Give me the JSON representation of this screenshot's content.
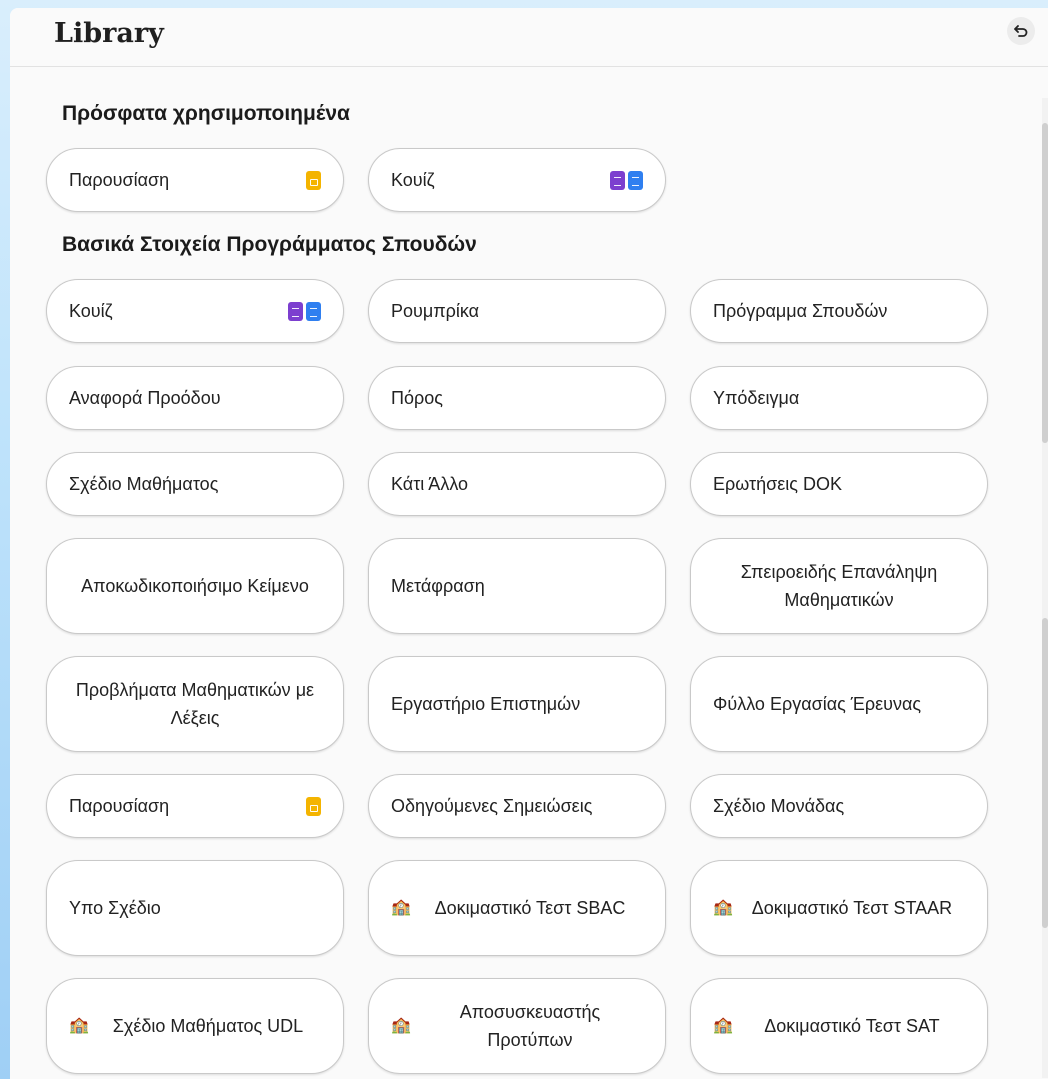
{
  "header": {
    "title": "Library",
    "undo_icon": "undo-icon"
  },
  "recent": {
    "title": "Πρόσφατα χρησιμοποιημένα",
    "items": [
      {
        "label": "Παρουσίαση",
        "icons": [
          "slides-icon"
        ]
      },
      {
        "label": "Κουίζ",
        "icons": [
          "forms-icon",
          "docs-icon"
        ]
      }
    ]
  },
  "curriculum": {
    "title": "Βασικά Στοιχεία Προγράμματος Σπουδών",
    "items": [
      {
        "label": "Κουίζ",
        "icons": [
          "forms-icon",
          "docs-icon"
        ]
      },
      {
        "label": "Ρουμπρίκα"
      },
      {
        "label": "Πρόγραμμα Σπουδών"
      },
      {
        "label": "Αναφορά Προόδου"
      },
      {
        "label": "Πόρος"
      },
      {
        "label": "Υπόδειγμα"
      },
      {
        "label": "Σχέδιο Μαθήματος"
      },
      {
        "label": "Κάτι Άλλο"
      },
      {
        "label": "Ερωτήσεις DOK"
      },
      {
        "label": "Αποκωδικοποιήσιμο Κείμενο"
      },
      {
        "label": "Μετάφραση"
      },
      {
        "label": "Σπειροειδής Επανάληψη Μαθηματικών"
      },
      {
        "label": "Προβλήματα Μαθηματικών με Λέξεις"
      },
      {
        "label": "Εργαστήριο Επιστημών"
      },
      {
        "label": "Φύλλο Εργασίας Έρευνας"
      },
      {
        "label": "Παρουσίαση",
        "icons": [
          "slides-icon"
        ]
      },
      {
        "label": "Οδηγούμενες Σημειώσεις"
      },
      {
        "label": "Σχέδιο Μονάδας"
      },
      {
        "label": "Υπο Σχέδιο"
      },
      {
        "label": "Δοκιμαστικό Τεστ SBAC",
        "icons": [
          "school-icon"
        ]
      },
      {
        "label": "Δοκιμαστικό Τεστ STAAR",
        "icons": [
          "school-icon"
        ]
      },
      {
        "label": "Σχέδιο Μαθήματος UDL",
        "icons": [
          "school-icon"
        ]
      },
      {
        "label": "Αποσυσκευαστής Προτύπων",
        "icons": [
          "school-icon"
        ]
      },
      {
        "label": "Δοκιμαστικό Τεστ SAT",
        "icons": [
          "school-icon"
        ]
      }
    ]
  },
  "colors": {
    "slides": "#f4b400",
    "forms": "#7c3fcf",
    "docs": "#2f7ff0"
  }
}
